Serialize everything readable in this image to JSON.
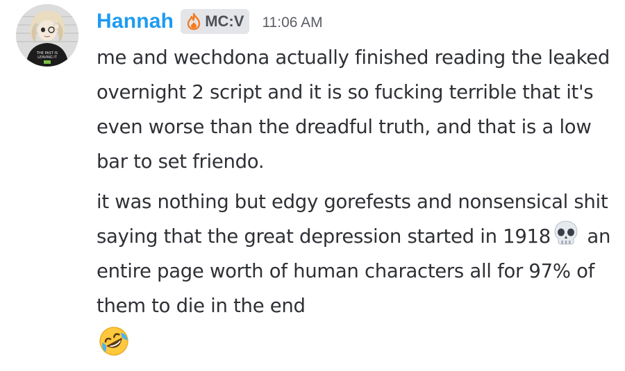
{
  "message": {
    "author": "Hannah",
    "role_tag": "MC:V",
    "role_tag_icon": "flame-icon",
    "timestamp": "11:06 AM",
    "avatar_shirt_text": "THE PAST IS\nLEAVING IT",
    "paragraph_1": "me and wechdona actually finished reading the leaked overnight 2 script and it is so fucking terrible that it's even worse than the dreadful truth, and that is a low bar to set friendo.",
    "paragraph_2_before_emoji": "it was nothing but edgy gorefests and nonsensical shit saying that the great depression started in 1918",
    "paragraph_2_emoji": "skull-emoji",
    "paragraph_2_after_emoji": " an entire page worth of human characters all for 97% of them to die in the end",
    "end_emoji": "rolling-on-floor-laughing-emoji"
  },
  "colors": {
    "username": "#1e9bf0",
    "text": "#2e3035",
    "timestamp": "#5c5e66",
    "tag_background": "#e4e5e8",
    "flame": "#f47b20"
  }
}
